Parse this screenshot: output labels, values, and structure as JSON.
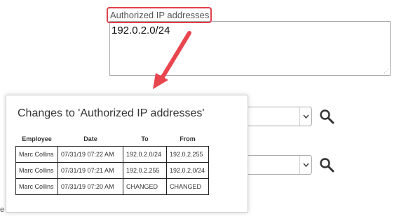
{
  "field": {
    "label": "Authorized IP addresses",
    "value": "192.0.2.0/24"
  },
  "popup": {
    "title": "Changes to 'Authorized IP addresses'",
    "columns": [
      "Employee",
      "Date",
      "To",
      "From"
    ],
    "rows": [
      [
        "Marc Collins",
        "07/31/19 07:22 AM",
        "192.0.2.0/24",
        "192.0.2.255"
      ],
      [
        "Marc Collins",
        "07/31/19 07:21 AM",
        "192.0.2.255",
        "192.0.2.0/24"
      ],
      [
        "Marc Collins",
        "07/31/19 07:20 AM",
        "CHANGED",
        "CHANGED"
      ]
    ]
  },
  "icons": {
    "search": "search-icon",
    "dropdown": "chevron-down-icon",
    "arrow": "annotation-arrow"
  },
  "colors": {
    "highlight": "#e0404a",
    "arrow": "#e8454f"
  }
}
